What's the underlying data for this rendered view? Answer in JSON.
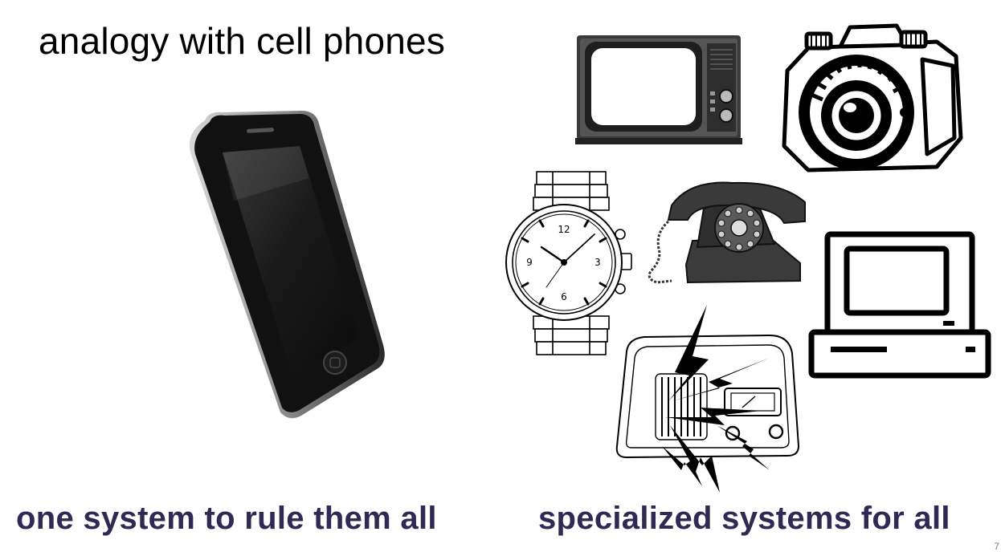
{
  "slide": {
    "title": "analogy with cell phones",
    "left_caption": "one system to rule them all",
    "right_caption": "specialized systems for all",
    "page_number": "7"
  },
  "watch": {
    "dial_numbers": [
      "12",
      "3",
      "6",
      "9"
    ]
  },
  "icons": [
    "smartphone-icon",
    "television-icon",
    "camera-icon",
    "wristwatch-icon",
    "rotary-telephone-icon",
    "computer-icon",
    "radio-icon"
  ]
}
